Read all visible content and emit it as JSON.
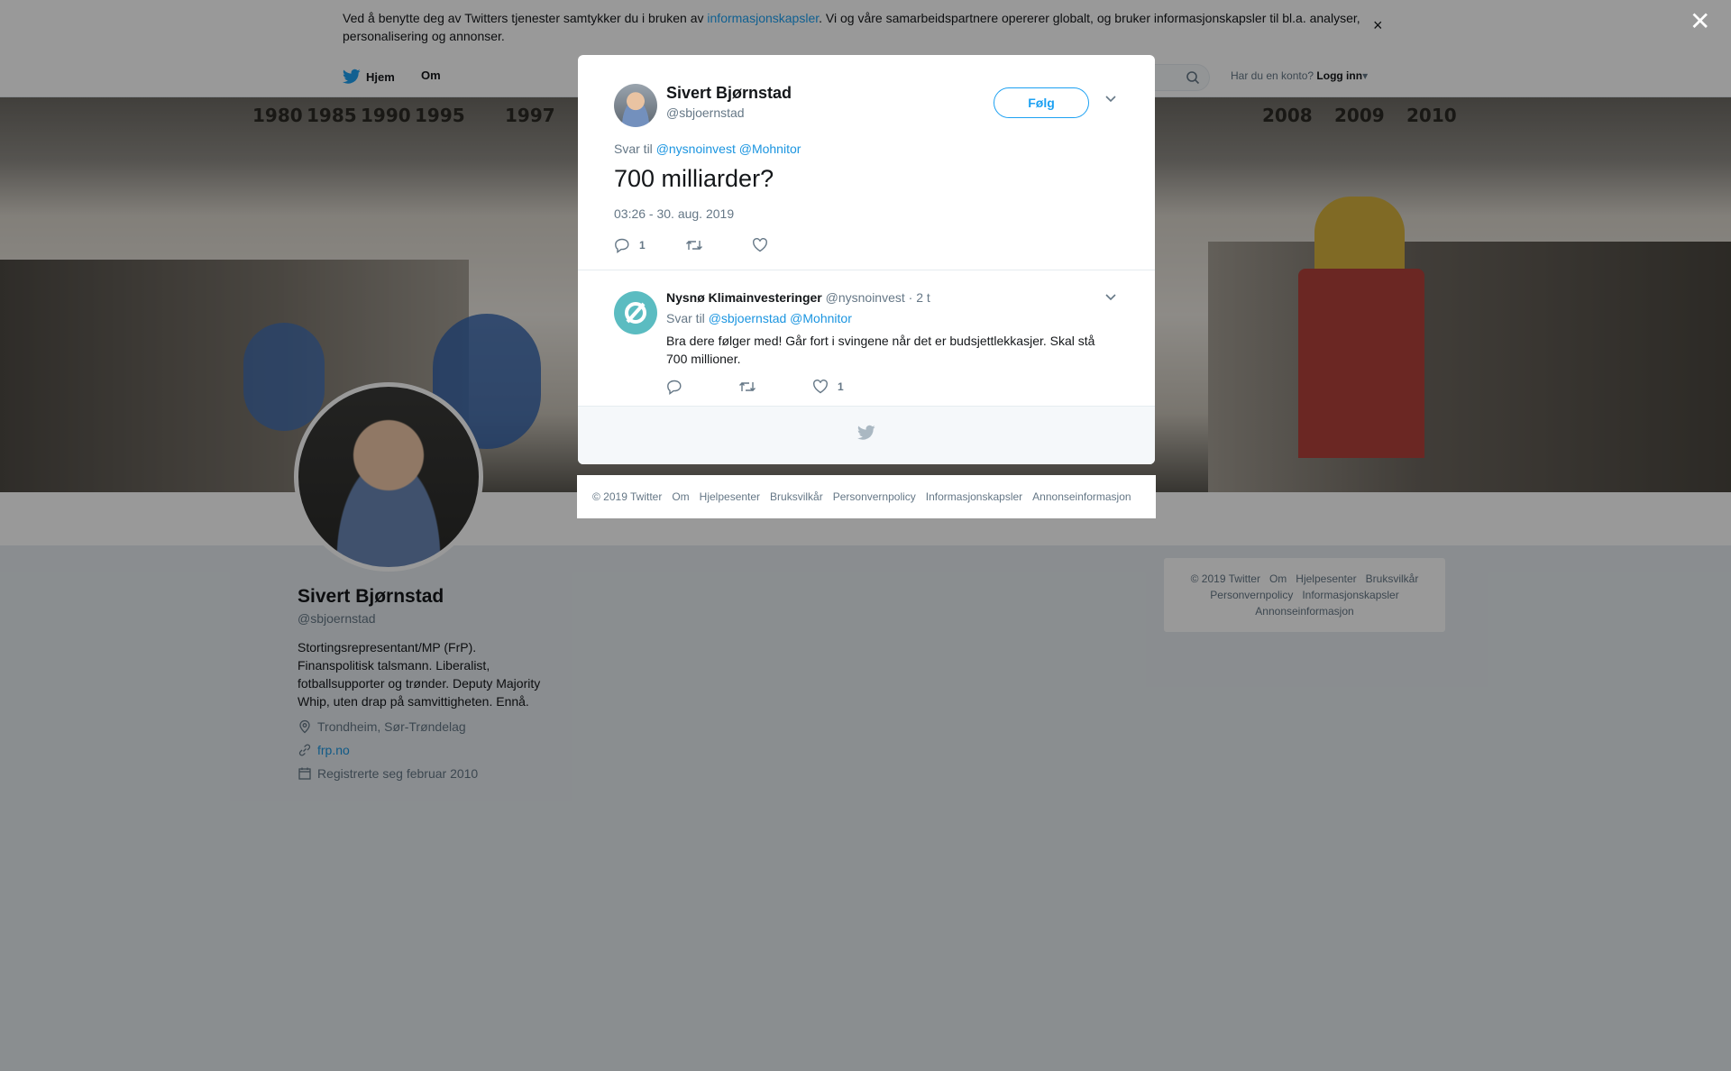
{
  "cookie_bar": {
    "text_before": "Ved å benytte deg av Twitters tjenester samtykker du i bruken av ",
    "link": "informasjonskapsler",
    "text_after": ". Vi og våre samarbeidspartnere opererer globalt, og bruker informasjonskapsler til bl.a. analyser, personalisering og annonser.",
    "close": "×"
  },
  "topnav": {
    "home": "Hjem",
    "about": "Om",
    "login_prompt": "Har du en konto?",
    "login": "Logg inn"
  },
  "banner": {
    "years": [
      "1980",
      "1985",
      "1990",
      "1995",
      "1997",
      "2008",
      "2009",
      "2010"
    ]
  },
  "profile": {
    "name": "Sivert Bjørnstad",
    "handle": "@sbjoernstad",
    "bio": "Stortingsrepresentant/MP (FrP). Finanspolitisk talsmann. Liberalist, fotballsupporter og trønder. Deputy Majority Whip, uten drap på samvittigheten. Ennå.",
    "location": "Trondheim, Sør-Trøndelag",
    "website": "frp.no",
    "joined": "Registrerte seg februar 2010"
  },
  "side_footer": {
    "links": [
      "© 2019 Twitter",
      "Om",
      "Hjelpesenter",
      "Bruksvilkår",
      "Personvernpolicy",
      "Informasjonskapsler",
      "Annonseinformasjon"
    ]
  },
  "overlay": {
    "close": "✕"
  },
  "modal": {
    "author_name": "Sivert Bjørnstad",
    "author_handle": "@sbjoernstad",
    "follow_label": "Følg",
    "reply_to_label": "Svar til",
    "reply_to_users": [
      "@nysnoinvest",
      "@Mohnitor"
    ],
    "text": "700 milliarder?",
    "timestamp": "03:26 - 30. aug. 2019",
    "reply_count": "1",
    "retweet_count": "",
    "like_count": ""
  },
  "reply": {
    "name": "Nysnø Klimainvesteringer",
    "handle": "@nysnoinvest",
    "time": "· 2 t",
    "reply_to_label": "Svar til",
    "reply_to_users": [
      "@sbjoernstad",
      "@Mohnitor"
    ],
    "text": "Bra dere følger med! Går fort i svingene når det er budsjettlekkasjer. Skal stå 700 millioner.",
    "reply_count": "",
    "retweet_count": "",
    "like_count": "1"
  },
  "modal_footer_links": [
    "© 2019 Twitter",
    "Om",
    "Hjelpesenter",
    "Bruksvilkår",
    "Personvernpolicy",
    "Informasjonskapsler",
    "Annonseinformasjon"
  ],
  "colors": {
    "accent": "#1da1f2",
    "link": "#1b95e0",
    "muted": "#657786",
    "text": "#14171a",
    "nysno": "#5bbcc1"
  }
}
